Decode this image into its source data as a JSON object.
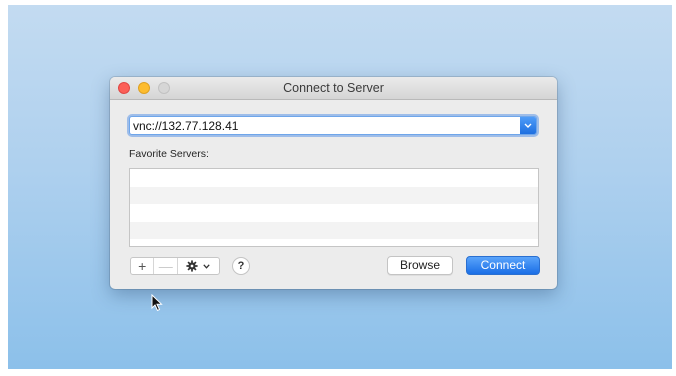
{
  "window": {
    "title": "Connect to Server"
  },
  "address": {
    "value": "vnc://132.77.128.41",
    "dropdown_icon": "chevron-down-icon"
  },
  "favorites": {
    "label": "Favorite Servers:",
    "items": []
  },
  "toolbar": {
    "add_label": "+",
    "remove_label": "—",
    "gear_icon": "gear-icon",
    "help_label": "?",
    "browse_label": "Browse",
    "connect_label": "Connect"
  },
  "colors": {
    "accent": "#1e6fe0",
    "close": "#fc5f57",
    "minimize": "#fdbc2e",
    "zoom_inactive": "#d6d6d6"
  }
}
